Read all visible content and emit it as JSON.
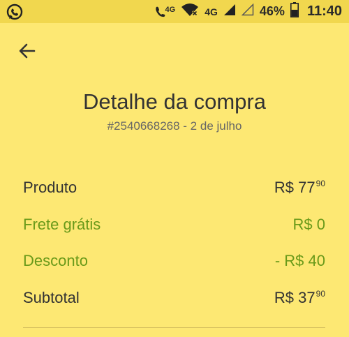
{
  "status_bar": {
    "network_small": "4G",
    "network": "4G",
    "battery": "46%",
    "time": "11:40",
    "icons": [
      "whatsapp-icon",
      "volte-call-icon",
      "wifi-off-icon",
      "signal-icon",
      "signal-empty-icon",
      "battery-icon"
    ]
  },
  "header": {
    "back_icon": "arrow-left-icon",
    "title": "Detalhe da compra",
    "subtitle": "#2540668268 - 2 de julho"
  },
  "summary": {
    "produto": {
      "label": "Produto",
      "value_main": "R$ 77",
      "value_cents": "90"
    },
    "frete": {
      "label": "Frete grátis",
      "value": "R$ 0"
    },
    "desconto": {
      "label": "Desconto",
      "value": "- R$ 40"
    },
    "subtotal": {
      "label": "Subtotal",
      "value_main": "R$ 37",
      "value_cents": "90"
    }
  },
  "colors": {
    "background": "#fde873",
    "status_bar": "#f1d74e",
    "text": "#333333",
    "accent_green": "#6a9a1a"
  }
}
